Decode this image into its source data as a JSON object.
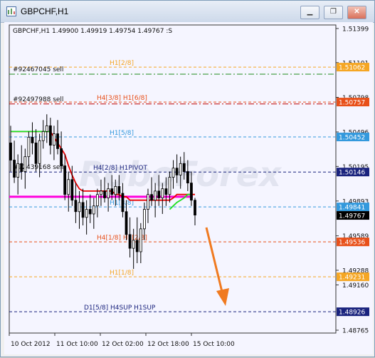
{
  "window": {
    "title": "GBPCHF,H1",
    "buttons": [
      {
        "name": "minimize-button",
        "icon": "minimize-icon"
      },
      {
        "name": "restore-button",
        "icon": "restore-icon"
      },
      {
        "name": "close-button",
        "icon": "close-icon"
      }
    ]
  },
  "chart_data": {
    "type": "candlestick",
    "symbol": "GBPCHF,H1",
    "ohlc_header": "GBPCHF,H1  1.49900 1.49919 1.49754 1.49767 :S",
    "y_range": [
      1.4874,
      1.5143
    ],
    "y_ticks": [
      1.51399,
      1.51101,
      1.50798,
      1.50496,
      1.50195,
      1.49893,
      1.49589,
      1.49288,
      1.4916,
      1.48765
    ],
    "x_tick_labels": [
      "10 Oct 2012",
      "11 Oct 10:00",
      "12 Oct 02:00",
      "12 Oct 18:00",
      "15 Oct 10:00"
    ],
    "levels": [
      {
        "price": 1.51062,
        "label": "H1[2/8]",
        "color": "#f5a623",
        "badge_bg": "#f5a623",
        "dash": "4,3",
        "text_color": "#f5a623"
      },
      {
        "price": 1.51,
        "label": "",
        "color": "#1e8a1e",
        "dash": "8,3,2,3",
        "badge": false
      },
      {
        "price": 1.50757,
        "label": "H4[3/8] H1[6/8]",
        "color": "#e8501a",
        "badge_bg": "#e8501a",
        "dash": "4,3",
        "text_color": "#e8501a"
      },
      {
        "price": 1.5074,
        "label": "",
        "color": "#c00000",
        "dash": "8,3,2,3",
        "badge": false
      },
      {
        "price": 1.50452,
        "label": "H1[5/8]",
        "color": "#3399dd",
        "badge_bg": "#3399dd",
        "dash": "4,3",
        "text_color": "#3399dd"
      },
      {
        "price": 1.50146,
        "label": "H4[2/8] H1PIVOT",
        "color": "#1a237e",
        "badge_bg": "#1a237e",
        "dash": "4,3",
        "text_color": "#1a237e"
      },
      {
        "price": 1.49841,
        "label": "H1[3/8]",
        "color": "#3399dd",
        "badge_bg": "#3399dd",
        "dash": "4,3",
        "text_color": "#3399dd"
      },
      {
        "price": 1.49536,
        "label": "H4[1/8] H1[2/8]",
        "color": "#e8501a",
        "badge_bg": "#e8501a",
        "dash": "4,3",
        "text_color": "#e8501a"
      },
      {
        "price": 1.49231,
        "label": "H1[1/8]",
        "color": "#f5a623",
        "badge_bg": "#f5a623",
        "dash": "4,3",
        "text_color": "#f5a623"
      },
      {
        "price": 1.48926,
        "label": "D1[5/8] H4SUP H1SUP",
        "color": "#1a237e",
        "badge_bg": "#1a237e",
        "dash": "4,3",
        "text_color": "#1a237e"
      }
    ],
    "order_labels": [
      {
        "text": "#92467045 sell",
        "price": 1.51
      },
      {
        "text": "#92497988 sell",
        "price": 1.5074
      },
      {
        "text": "#92439168 sell",
        "price": 1.50146
      }
    ],
    "current_price": {
      "price": 1.49767,
      "label": "1.49767"
    },
    "magenta_level": 1.4993,
    "candles": [
      [
        1.504,
        1.5055,
        1.5015,
        1.5025
      ],
      [
        1.5025,
        1.5042,
        1.5005,
        1.501
      ],
      [
        1.501,
        1.503,
        1.4995,
        1.5022
      ],
      [
        1.5022,
        1.5038,
        1.5008,
        1.5015
      ],
      [
        1.5015,
        1.5035,
        1.5,
        1.5028
      ],
      [
        1.5028,
        1.505,
        1.502,
        1.5045
      ],
      [
        1.5045,
        1.5058,
        1.503,
        1.504
      ],
      [
        1.504,
        1.5052,
        1.5015,
        1.5022
      ],
      [
        1.5022,
        1.5048,
        1.501,
        1.5042
      ],
      [
        1.5042,
        1.506,
        1.5035,
        1.505
      ],
      [
        1.505,
        1.5065,
        1.504,
        1.5055
      ],
      [
        1.5055,
        1.5062,
        1.503,
        1.5038
      ],
      [
        1.5038,
        1.5055,
        1.5025,
        1.5048
      ],
      [
        1.5048,
        1.506,
        1.503,
        1.5035
      ],
      [
        1.5035,
        1.505,
        1.5015,
        1.502
      ],
      [
        1.502,
        1.503,
        1.499,
        1.4995
      ],
      [
        1.4995,
        1.5015,
        1.498,
        1.5008
      ],
      [
        1.5008,
        1.502,
        1.4985,
        1.499
      ],
      [
        1.499,
        1.5005,
        1.497,
        1.498
      ],
      [
        1.498,
        1.4998,
        1.4965,
        1.4988
      ],
      [
        1.4988,
        1.5,
        1.4968,
        1.4975
      ],
      [
        1.4975,
        1.499,
        1.496,
        1.4982
      ],
      [
        1.4982,
        1.4995,
        1.497,
        1.4978
      ],
      [
        1.4978,
        1.4992,
        1.4965,
        1.4985
      ],
      [
        1.4985,
        1.5,
        1.4975,
        1.4995
      ],
      [
        1.4995,
        1.5008,
        1.4985,
        1.4998
      ],
      [
        1.4998,
        1.501,
        1.4988,
        1.4992
      ],
      [
        1.4992,
        1.5005,
        1.498,
        1.5
      ],
      [
        1.5,
        1.5012,
        1.499,
        1.4995
      ],
      [
        1.4995,
        1.5008,
        1.4985,
        1.5002
      ],
      [
        1.5002,
        1.5012,
        1.499,
        1.4996
      ],
      [
        1.4996,
        1.5005,
        1.4975,
        1.498
      ],
      [
        1.498,
        1.499,
        1.4955,
        1.496
      ],
      [
        1.496,
        1.4975,
        1.494,
        1.4948
      ],
      [
        1.4948,
        1.4965,
        1.493,
        1.4955
      ],
      [
        1.4955,
        1.4975,
        1.4935,
        1.4945
      ],
      [
        1.4945,
        1.497,
        1.4935,
        1.4965
      ],
      [
        1.4965,
        1.4988,
        1.4955,
        1.4982
      ],
      [
        1.4982,
        1.5,
        1.497,
        1.4995
      ],
      [
        1.4995,
        1.501,
        1.4985,
        1.499
      ],
      [
        1.499,
        1.5005,
        1.4975,
        1.4998
      ],
      [
        1.4998,
        1.5012,
        1.4985,
        1.4992
      ],
      [
        1.4992,
        1.5005,
        1.4978,
        1.5
      ],
      [
        1.5,
        1.501,
        1.4985,
        1.4995
      ],
      [
        1.4995,
        1.5015,
        1.4988,
        1.501
      ],
      [
        1.501,
        1.5025,
        1.5,
        1.5018
      ],
      [
        1.5018,
        1.503,
        1.5005,
        1.5012
      ],
      [
        1.5012,
        1.5028,
        1.5,
        1.5022
      ],
      [
        1.5022,
        1.5032,
        1.5008,
        1.5015
      ],
      [
        1.5015,
        1.5025,
        1.4998,
        1.5005
      ],
      [
        1.5005,
        1.5015,
        1.4985,
        1.499
      ],
      [
        1.499,
        1.4992,
        1.4968,
        1.4977
      ]
    ],
    "red_line": [
      1.505,
      1.505,
      1.505,
      1.505,
      1.505,
      1.505,
      1.505,
      1.505,
      1.505,
      1.505,
      1.505,
      1.505,
      1.5045,
      1.504,
      1.5035,
      1.503,
      1.502,
      1.5012,
      1.5005,
      1.5,
      1.4998,
      1.4998,
      1.4998,
      1.4998,
      1.4998,
      1.4998,
      1.4998,
      1.4998,
      1.4998,
      1.4995,
      1.4995,
      1.4993,
      1.4993,
      1.499,
      1.499,
      1.499,
      1.499,
      1.499,
      1.499,
      1.499,
      1.499,
      1.499,
      1.499,
      1.499,
      1.499,
      1.4992,
      1.4995,
      1.4995,
      1.4995,
      1.4995,
      1.4995,
      1.4995
    ],
    "green_line": [
      1.505,
      1.505,
      1.505,
      1.505,
      1.505,
      1.505,
      1.505,
      1.505,
      1.505,
      1.505,
      1.505,
      1.505,
      null,
      null,
      null,
      null,
      null,
      null,
      null,
      null,
      null,
      null,
      null,
      null,
      null,
      null,
      null,
      null,
      null,
      null,
      null,
      null,
      null,
      null,
      null,
      null,
      null,
      null,
      null,
      null,
      null,
      null,
      null,
      null,
      1.4982,
      1.4985,
      1.4988,
      1.499,
      1.4992,
      1.4995,
      1.4995,
      null
    ],
    "watermark": "RoboForex"
  }
}
